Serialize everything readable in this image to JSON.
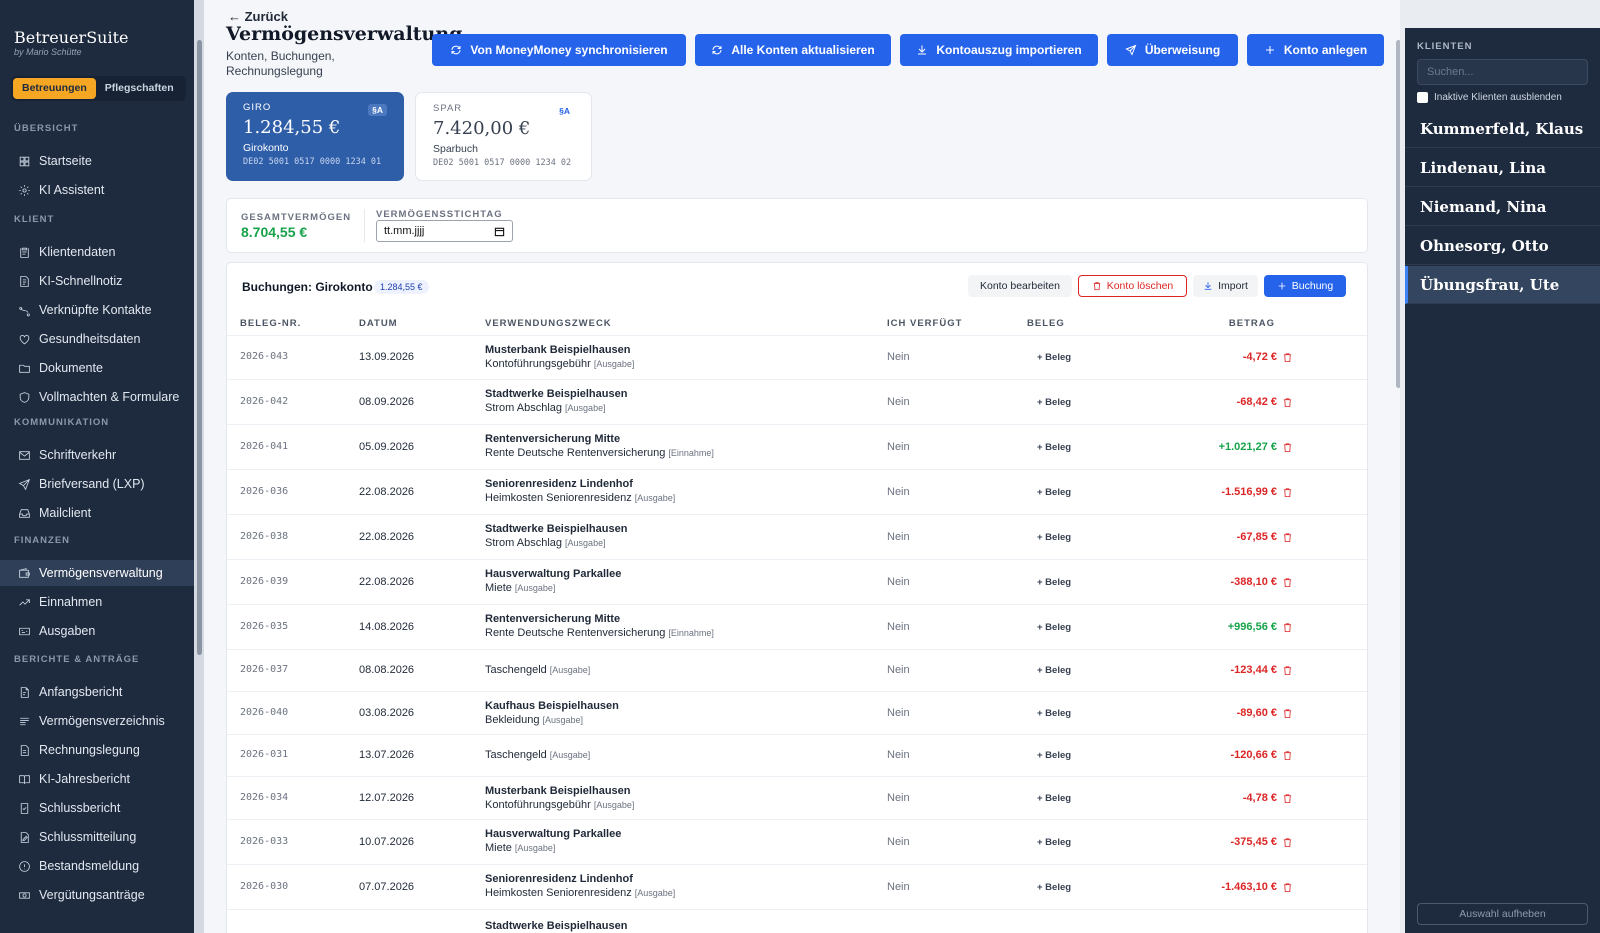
{
  "app": {
    "name": "BetreuerSuite",
    "byline": "by Mario Schütte"
  },
  "mode_tabs": [
    "Betreuungen",
    "Pflegschaften"
  ],
  "sidebar": {
    "sections": [
      {
        "title": "ÜBERSICHT",
        "items": [
          "Startseite",
          "KI Assistent"
        ]
      },
      {
        "title": "KLIENT",
        "items": [
          "Klientendaten",
          "KI-Schnellnotiz",
          "Verknüpfte Kontakte",
          "Gesundheitsdaten",
          "Dokumente",
          "Vollmachten & Formulare"
        ]
      },
      {
        "title": "KOMMUNIKATION",
        "items": [
          "Schriftverkehr",
          "Briefversand (LXP)",
          "Mailclient"
        ]
      },
      {
        "title": "FINANZEN",
        "items": [
          "Vermögensverwaltung",
          "Einnahmen",
          "Ausgaben"
        ]
      },
      {
        "title": "BERICHTE & ANTRÄGE",
        "items": [
          "Anfangsbericht",
          "Vermögensverzeichnis",
          "Rechnungslegung",
          "KI-Jahresbericht",
          "Schlussbericht",
          "Schlussmitteilung",
          "Bestandsmeldung",
          "Vergütungsanträge"
        ]
      }
    ],
    "active_item": "Vermögensverwaltung"
  },
  "header": {
    "back": "← Zurück",
    "title": "Vermögensverwaltung",
    "subtitle": "Konten, Buchungen, Rechnungslegung",
    "buttons": [
      "Von MoneyMoney synchronisieren",
      "Alle Konten aktualisieren",
      "Kontoauszug importieren",
      "Überweisung",
      "Konto anlegen"
    ]
  },
  "accounts": [
    {
      "kind": "GIRO",
      "badge": "§A",
      "balance": "1.284,55 €",
      "name": "Girokonto",
      "iban": "DE02 5001 0517 0000 1234 01"
    },
    {
      "kind": "SPAR",
      "badge": "§A",
      "balance": "7.420,00 €",
      "name": "Sparbuch",
      "iban": "DE02 5001 0517 0000 1234 02"
    }
  ],
  "summary": {
    "total_label": "GESAMTVERMÖGEN",
    "total_value": "8.704,55 €",
    "date_label": "VERMÖGENSSTICHTAG",
    "date_placeholder": "tt.mm.jjjj"
  },
  "bookings": {
    "title": "Buchungen: Girokonto",
    "balance": "1.284,55 €",
    "actions": [
      "Konto bearbeiten",
      "Konto löschen",
      "Import",
      "Buchung"
    ],
    "columns": [
      "BELEG-NR.",
      "DATUM",
      "VERWENDUNGSZWECK",
      "ICH VERFÜGT",
      "BELEG",
      "BETRAG"
    ],
    "rows": [
      {
        "no": "2026-043",
        "date": "13.09.2026",
        "payee": "Musterbank Beispielhausen",
        "purpose": "Kontoführungsgebühr",
        "tag": "[Ausgabe]",
        "ich": "Nein",
        "beleg": "+ Beleg",
        "amount": "-4,72 €"
      },
      {
        "no": "2026-042",
        "date": "08.09.2026",
        "payee": "Stadtwerke Beispielhausen",
        "purpose": "Strom Abschlag",
        "tag": "[Ausgabe]",
        "ich": "Nein",
        "beleg": "+ Beleg",
        "amount": "-68,42 €"
      },
      {
        "no": "2026-041",
        "date": "05.09.2026",
        "payee": "Rentenversicherung Mitte",
        "purpose": "Rente Deutsche Rentenversicherung",
        "tag": "[Einnahme]",
        "ich": "Nein",
        "beleg": "+ Beleg",
        "amount": "+1.021,27 €"
      },
      {
        "no": "2026-036",
        "date": "22.08.2026",
        "payee": "Seniorenresidenz Lindenhof",
        "purpose": "Heimkosten Seniorenresidenz",
        "tag": "[Ausgabe]",
        "ich": "Nein",
        "beleg": "+ Beleg",
        "amount": "-1.516,99 €"
      },
      {
        "no": "2026-038",
        "date": "22.08.2026",
        "payee": "Stadtwerke Beispielhausen",
        "purpose": "Strom Abschlag",
        "tag": "[Ausgabe]",
        "ich": "Nein",
        "beleg": "+ Beleg",
        "amount": "-67,85 €"
      },
      {
        "no": "2026-039",
        "date": "22.08.2026",
        "payee": "Hausverwaltung Parkallee",
        "purpose": "Miete",
        "tag": "[Ausgabe]",
        "ich": "Nein",
        "beleg": "+ Beleg",
        "amount": "-388,10 €"
      },
      {
        "no": "2026-035",
        "date": "14.08.2026",
        "payee": "Rentenversicherung Mitte",
        "purpose": "Rente Deutsche Rentenversicherung",
        "tag": "[Einnahme]",
        "ich": "Nein",
        "beleg": "+ Beleg",
        "amount": "+996,56 €"
      },
      {
        "no": "2026-037",
        "date": "08.08.2026",
        "payee": "",
        "purpose": "Taschengeld",
        "tag": "[Ausgabe]",
        "ich": "Nein",
        "beleg": "+ Beleg",
        "amount": "-123,44 €"
      },
      {
        "no": "2026-040",
        "date": "03.08.2026",
        "payee": "Kaufhaus Beispielhausen",
        "purpose": "Bekleidung",
        "tag": "[Ausgabe]",
        "ich": "Nein",
        "beleg": "+ Beleg",
        "amount": "-89,60 €"
      },
      {
        "no": "2026-031",
        "date": "13.07.2026",
        "payee": "",
        "purpose": "Taschengeld",
        "tag": "[Ausgabe]",
        "ich": "Nein",
        "beleg": "+ Beleg",
        "amount": "-120,66 €"
      },
      {
        "no": "2026-034",
        "date": "12.07.2026",
        "payee": "Musterbank Beispielhausen",
        "purpose": "Kontoführungsgebühr",
        "tag": "[Ausgabe]",
        "ich": "Nein",
        "beleg": "+ Beleg",
        "amount": "-4,78 €"
      },
      {
        "no": "2026-033",
        "date": "10.07.2026",
        "payee": "Hausverwaltung Parkallee",
        "purpose": "Miete",
        "tag": "[Ausgabe]",
        "ich": "Nein",
        "beleg": "+ Beleg",
        "amount": "-375,45 €"
      },
      {
        "no": "2026-030",
        "date": "07.07.2026",
        "payee": "Seniorenresidenz Lindenhof",
        "purpose": "Heimkosten Seniorenresidenz",
        "tag": "[Ausgabe]",
        "ich": "Nein",
        "beleg": "+ Beleg",
        "amount": "-1.463,10 €"
      },
      {
        "no": "",
        "date": "",
        "payee": "Stadtwerke Beispielhausen",
        "purpose": "",
        "tag": "",
        "ich": "",
        "beleg": "",
        "amount": ""
      }
    ]
  },
  "clients_panel": {
    "title": "KLIENTEN",
    "search_placeholder": "Suchen...",
    "hide_inactive": "Inaktive Klienten ausblenden",
    "clients": [
      "Kummerfeld, Klaus",
      "Lindenau, Lina",
      "Niemand, Nina",
      "Ohnesorg, Otto",
      "Übungsfrau, Ute"
    ],
    "active_client": "Übungsfrau, Ute",
    "clear": "Auswahl aufheben"
  }
}
